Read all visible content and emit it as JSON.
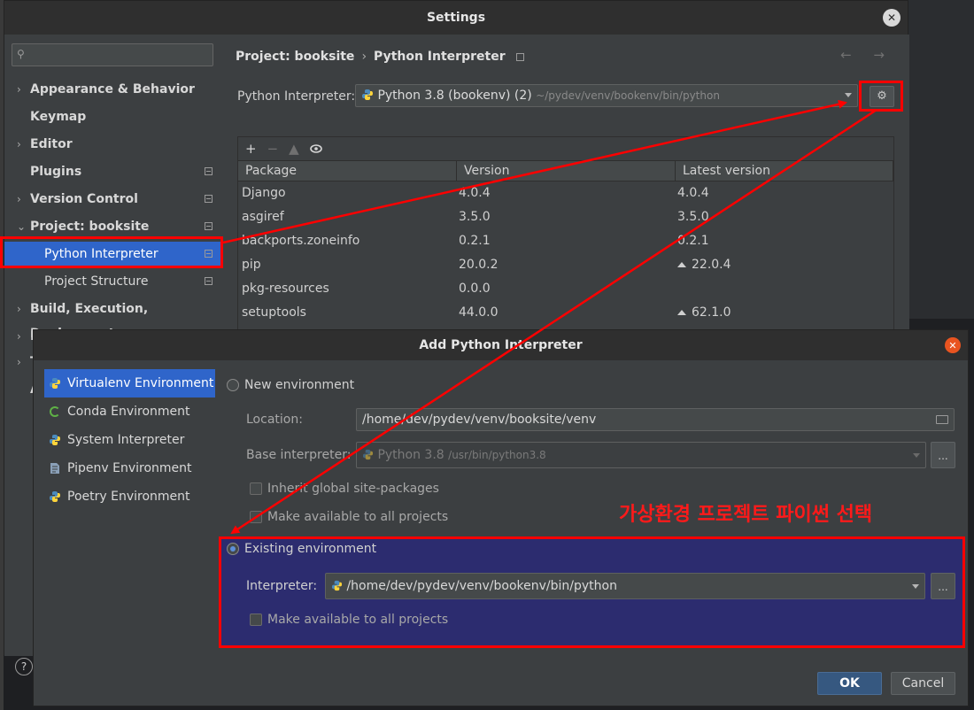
{
  "settings": {
    "title": "Settings",
    "close_glyph": "✕",
    "sidebar": {
      "items": [
        {
          "label": "Appearance & Behavior",
          "arrow": "›"
        },
        {
          "label": "Keymap",
          "arrow": ""
        },
        {
          "label": "Editor",
          "arrow": "›"
        },
        {
          "label": "Plugins",
          "arrow": ""
        },
        {
          "label": "Version Control",
          "arrow": "›"
        },
        {
          "label": "Project: booksite",
          "arrow": "⌄"
        },
        {
          "label": "Python Interpreter",
          "arrow": ""
        },
        {
          "label": "Project Structure",
          "arrow": ""
        },
        {
          "label": "Build, Execution, Deployment",
          "arrow": "›"
        }
      ],
      "partial_arrows": [
        "›",
        "›"
      ],
      "partial_letters": [
        "I",
        "T",
        "A"
      ],
      "help": "?"
    },
    "breadcrumb": {
      "project": "Project: booksite",
      "sep": "›",
      "page": "Python Interpreter"
    },
    "nav_arrows": "← →",
    "interpreter": {
      "label": "Python Interpreter:",
      "name": "Python 3.8 (bookenv) (2)",
      "path": "~/pydev/venv/bookenv/bin/python"
    },
    "toolbar": {
      "add": "+",
      "remove": "−",
      "up": "▲",
      "show": "👁"
    },
    "packages": {
      "headers": [
        "Package",
        "Version",
        "Latest version"
      ],
      "rows": [
        {
          "name": "Django",
          "version": "4.0.4",
          "latest": "4.0.4",
          "upgrade": false
        },
        {
          "name": "asgiref",
          "version": "3.5.0",
          "latest": "3.5.0",
          "upgrade": false
        },
        {
          "name": "backports.zoneinfo",
          "version": "0.2.1",
          "latest": "0.2.1",
          "upgrade": false
        },
        {
          "name": "pip",
          "version": "20.0.2",
          "latest": "22.0.4",
          "upgrade": true
        },
        {
          "name": "pkg-resources",
          "version": "0.0.0",
          "latest": "",
          "upgrade": false
        },
        {
          "name": "setuptools",
          "version": "44.0.0",
          "latest": "62.1.0",
          "upgrade": true
        }
      ]
    }
  },
  "dialog": {
    "title": "Add Python Interpreter",
    "close_glyph": "✕",
    "environments": [
      {
        "label": "Virtualenv Environment",
        "icon": "python-icon"
      },
      {
        "label": "Conda Environment",
        "icon": "conda-icon"
      },
      {
        "label": "System Interpreter",
        "icon": "python-icon"
      },
      {
        "label": "Pipenv Environment",
        "icon": "pipenv-icon"
      },
      {
        "label": "Poetry Environment",
        "icon": "python-icon"
      }
    ],
    "new_env": {
      "label": "New environment",
      "location_label": "Location:",
      "location_value": "/home/dev/pydev/venv/booksite/venv",
      "base_label": "Base interpreter:",
      "base_name": "Python 3.8",
      "base_path": "/usr/bin/python3.8",
      "inherit_label": "Inherit global site-packages",
      "available_label": "Make available to all projects"
    },
    "existing_env": {
      "label": "Existing environment",
      "interpreter_label": "Interpreter:",
      "interpreter_value": "/home/dev/pydev/venv/bookenv/bin/python",
      "available_label": "Make available to all projects"
    },
    "dots": "...",
    "ok": "OK",
    "cancel": "Cancel"
  },
  "annotation": {
    "note": "가상환경 프로젝트 파이썬 선택",
    "color": "#ff0000"
  }
}
